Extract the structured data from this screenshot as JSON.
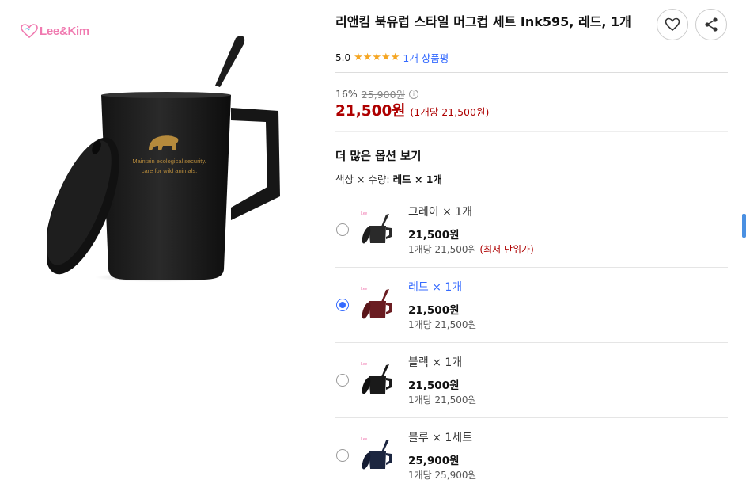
{
  "brand": {
    "logo_text": "Lee&Kim"
  },
  "product": {
    "title": "리앤킴 북유럽 스타일 머그컵 세트 Ink595, 레드, 1개",
    "mug_print_line1": "Maintain ecological security.",
    "mug_print_line2": "care for wild animals."
  },
  "rating": {
    "score": "5.0",
    "stars": "★★★★★",
    "review_link": "1개 상품평"
  },
  "price": {
    "discount": "16%",
    "original": "25,900원",
    "info_icon": "i",
    "sale": "21,500원",
    "unit": "(1개당 21,500원)"
  },
  "options": {
    "heading": "더 많은 옵션 보기",
    "selection_label": "색상 × 수량:",
    "selection_value": "레드 × 1개",
    "items": [
      {
        "name": "그레이 × 1개",
        "price": "21,500원",
        "unit": "1개당 21,500원",
        "badge": "(최저 단위가)",
        "selected": false,
        "color": "#2a2a2a"
      },
      {
        "name": "레드 × 1개",
        "price": "21,500원",
        "unit": "1개당 21,500원",
        "badge": "",
        "selected": true,
        "color": "#6b1d22"
      },
      {
        "name": "블랙 × 1개",
        "price": "21,500원",
        "unit": "1개당 21,500원",
        "badge": "",
        "selected": false,
        "color": "#1a1a1a"
      },
      {
        "name": "블루 × 1세트",
        "price": "25,900원",
        "unit": "1개당 25,900원",
        "badge": "",
        "selected": false,
        "color": "#1c2640"
      }
    ]
  },
  "icons": {
    "favorite": "heart-icon",
    "share": "share-icon",
    "info": "info-icon"
  },
  "colors": {
    "sale_red": "#ae0000",
    "link_blue": "#346aff",
    "star": "#f5a623"
  }
}
